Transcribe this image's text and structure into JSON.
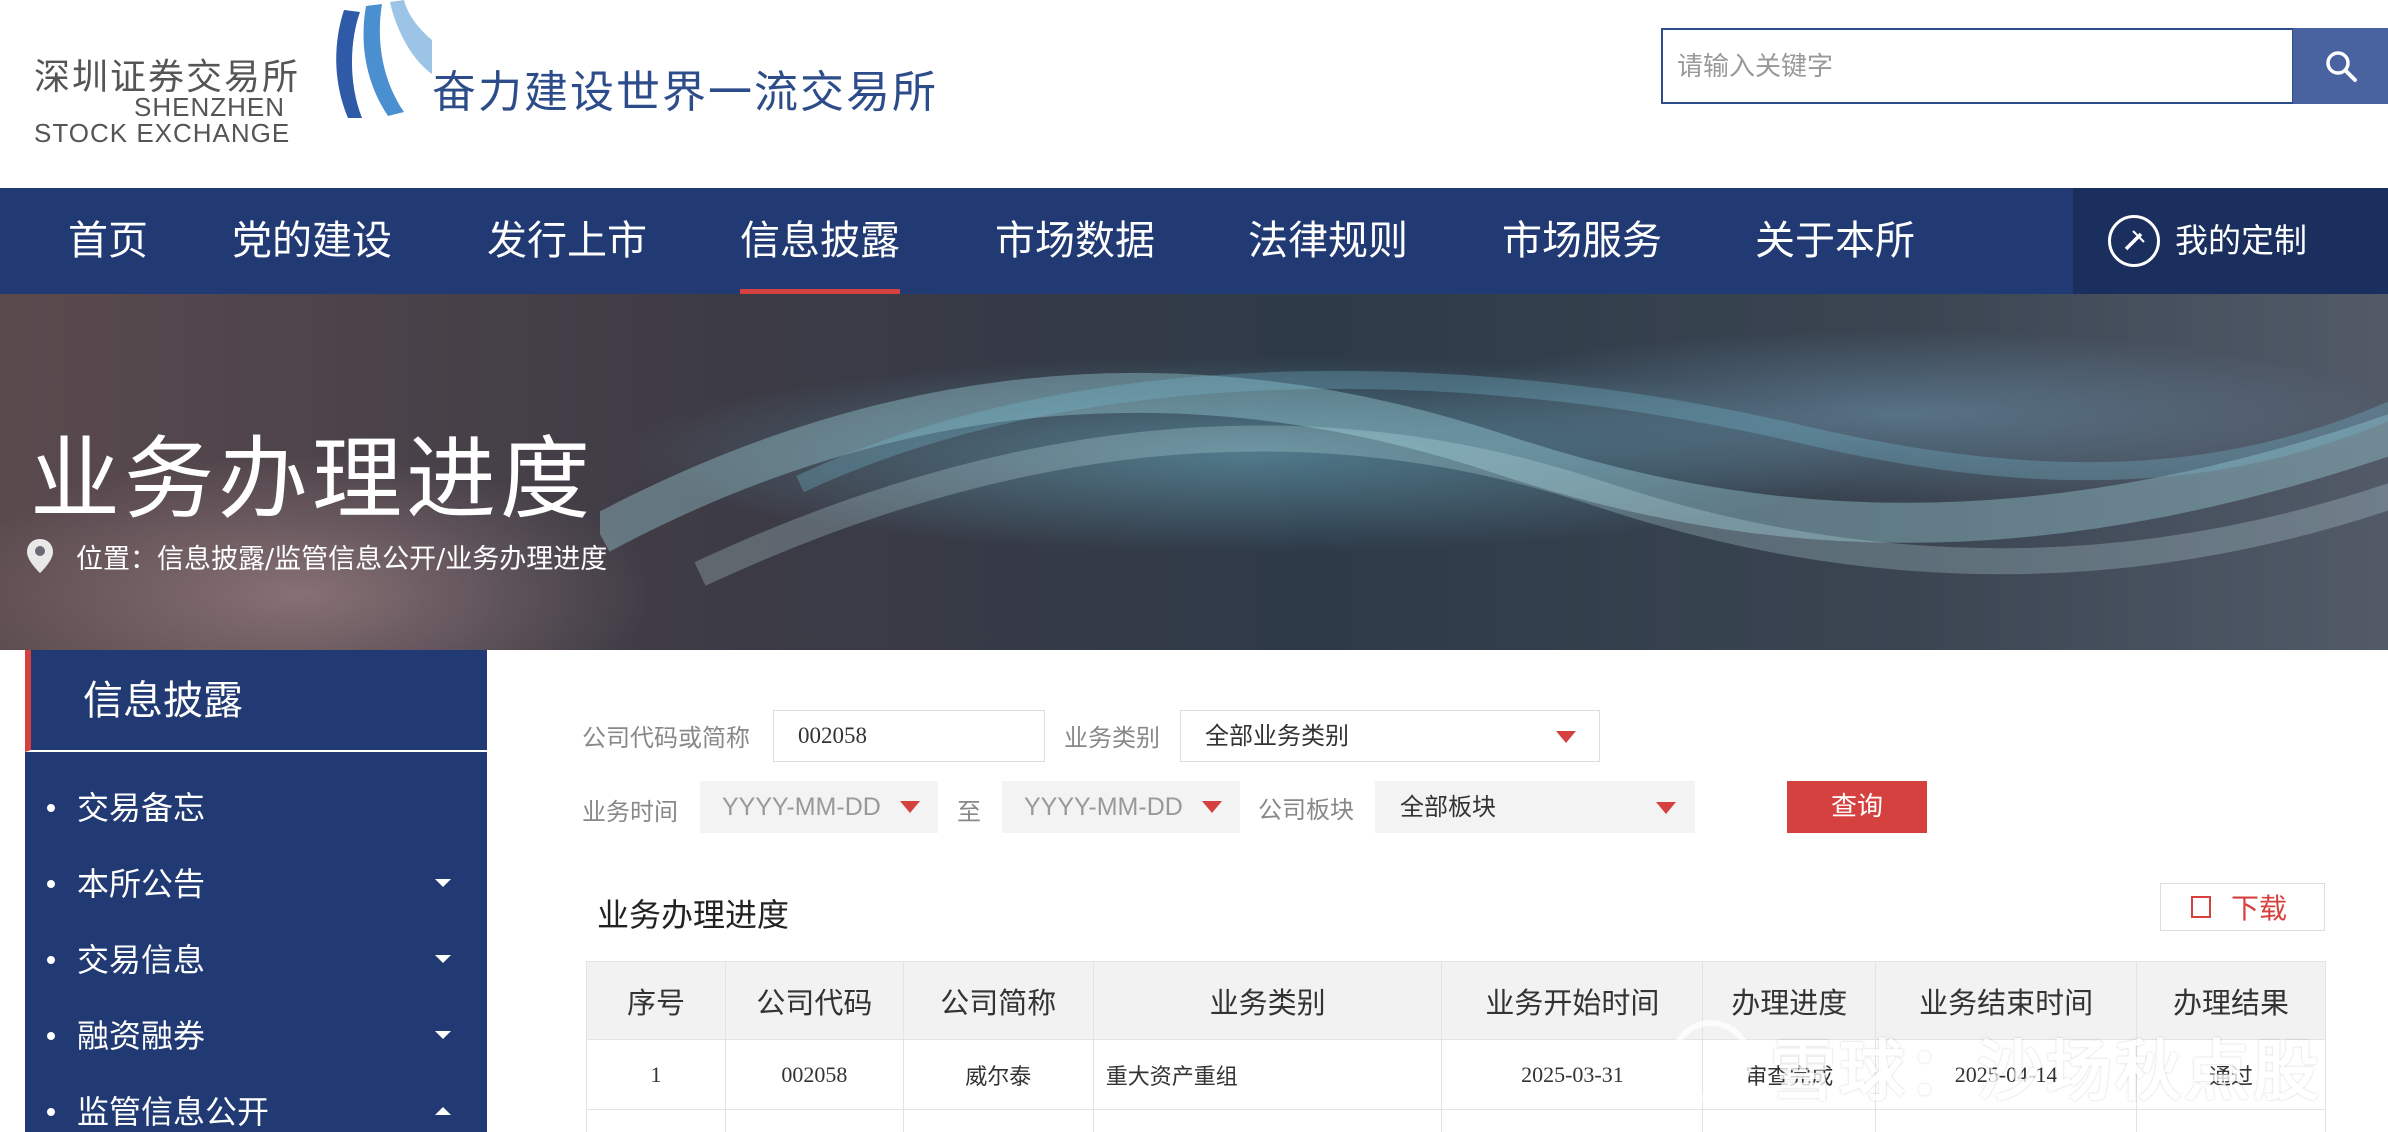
{
  "header": {
    "logo_cn": "深圳证券交易所",
    "logo_en_line1": "SHENZHEN",
    "logo_en_line2": "STOCK EXCHANGE",
    "slogan": "奋力建设世界一流交易所",
    "search_placeholder": "请输入关键字",
    "search_icon": "search-icon"
  },
  "nav": {
    "items": [
      {
        "label": "首页",
        "active": false
      },
      {
        "label": "党的建设",
        "active": false
      },
      {
        "label": "发行上市",
        "active": false
      },
      {
        "label": "信息披露",
        "active": true
      },
      {
        "label": "市场数据",
        "active": false
      },
      {
        "label": "法律规则",
        "active": false
      },
      {
        "label": "市场服务",
        "active": false
      },
      {
        "label": "关于本所",
        "active": false
      }
    ],
    "custom_label": "我的定制"
  },
  "banner": {
    "title": "业务办理进度",
    "breadcrumb": "位置：信息披露/监管信息公开/业务办理进度"
  },
  "sidebar": {
    "title": "信息披露",
    "items": [
      {
        "label": "交易备忘",
        "caret": "none"
      },
      {
        "label": "本所公告",
        "caret": "down"
      },
      {
        "label": "交易信息",
        "caret": "down"
      },
      {
        "label": "融资融券",
        "caret": "down"
      },
      {
        "label": "监管信息公开",
        "caret": "up"
      }
    ]
  },
  "filters": {
    "code_label": "公司代码或简称",
    "code_value": "002058",
    "type_label": "业务类别",
    "type_value": "全部业务类别",
    "time_label": "业务时间",
    "date_from_placeholder": "YYYY-MM-DD",
    "to_label": "至",
    "date_to_placeholder": "YYYY-MM-DD",
    "board_label": "公司板块",
    "board_value": "全部板块",
    "query_label": "查询"
  },
  "results": {
    "title": "业务办理进度",
    "download_label": "下载",
    "columns": [
      "序号",
      "公司代码",
      "公司简称",
      "业务类别",
      "业务开始时间",
      "办理进度",
      "业务结束时间",
      "办理结果"
    ],
    "rows": [
      [
        "1",
        "002058",
        "威尔泰",
        "重大资产重组",
        "2025-03-31",
        "审查完成",
        "2025-04-14",
        "通过"
      ]
    ]
  },
  "watermark": {
    "text": "雪球：沙场秋点股"
  },
  "colors": {
    "brand_navy": "#213a73",
    "accent_red": "#d5413f",
    "slogan_blue": "#2d4d8a"
  }
}
